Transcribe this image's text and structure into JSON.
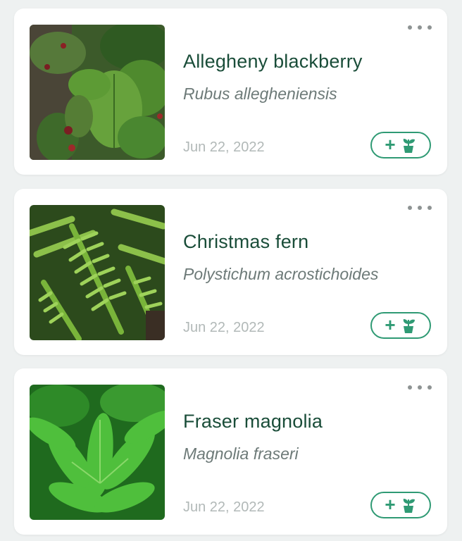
{
  "accent_color": "#2f9a74",
  "title_color": "#1a4d39",
  "plants": [
    {
      "common_name": "Allegheny blackberry",
      "scientific_name": "Rubus allegheniensis",
      "date": "Jun 22, 2022",
      "add_icon": "plus-icon",
      "plant_icon": "potted-plant-icon",
      "more_icon": "more-horizontal-icon"
    },
    {
      "common_name": "Christmas fern",
      "scientific_name": "Polystichum acrostichoides",
      "date": "Jun 22, 2022",
      "add_icon": "plus-icon",
      "plant_icon": "potted-plant-icon",
      "more_icon": "more-horizontal-icon"
    },
    {
      "common_name": "Fraser magnolia",
      "scientific_name": "Magnolia fraseri",
      "date": "Jun 22, 2022",
      "add_icon": "plus-icon",
      "plant_icon": "potted-plant-icon",
      "more_icon": "more-horizontal-icon"
    }
  ]
}
